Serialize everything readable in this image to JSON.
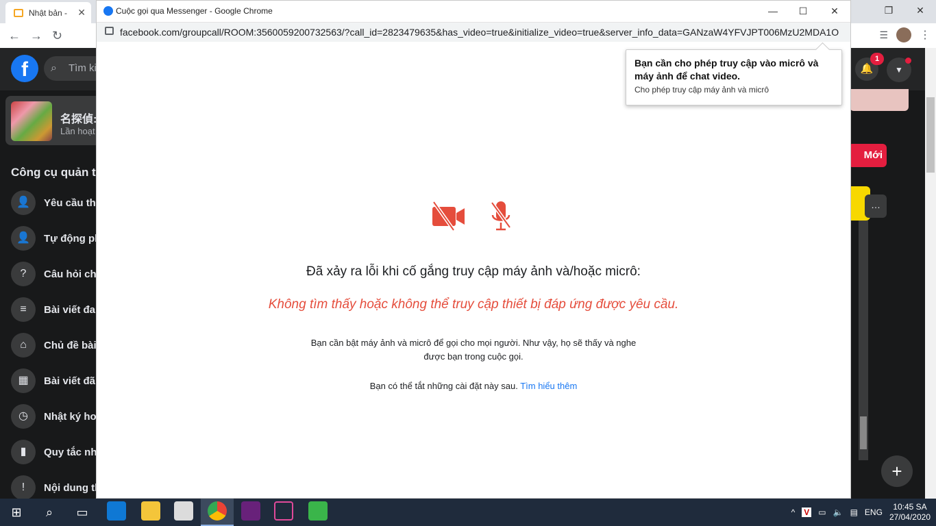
{
  "bg_browser": {
    "tab_title": "Nhật bản -",
    "tab_close": "✕"
  },
  "facebook": {
    "search_placeholder": "Tìm ki",
    "group_name": "名探偵:",
    "group_sub": "Lần hoạt",
    "tools_title": "Công cụ quản tr",
    "tools": [
      {
        "label": "Yêu cầu tha",
        "icon": "user-plus-icon"
      },
      {
        "label": "Tự động ph",
        "icon": "user-check-icon"
      },
      {
        "label": "Câu hỏi chọ",
        "icon": "member-questions-icon"
      },
      {
        "label": "Bài viết đan",
        "icon": "post-icon"
      },
      {
        "label": "Chủ đề bài",
        "icon": "tag-icon"
      },
      {
        "label": "Bài viết đã",
        "icon": "calendar-icon"
      },
      {
        "label": "Nhật ký ho",
        "icon": "clock-icon"
      },
      {
        "label": "Quy tắc nhó",
        "icon": "book-icon"
      },
      {
        "label": "Nội dung th",
        "icon": "alert-icon"
      }
    ],
    "notification_count": "1",
    "new_button": "Mới"
  },
  "popup": {
    "window_title": "Cuộc gọi qua Messenger - Google Chrome",
    "url": "facebook.com/groupcall/ROOM:3560059200732563/?call_id=2823479635&has_video=true&initialize_video=true&server_info_data=GANzaW4YFVJPT006MzU2MDA1O...",
    "tooltip_title": "Bạn cần cho phép truy cập vào micrô và máy ảnh để chat video.",
    "tooltip_sub": "Cho phép truy cập máy ảnh và micrô",
    "error_title": "Đã xảy ra lỗi khi cố gắng truy cập máy ảnh và/hoặc micrô:",
    "error_message": "Không tìm thấy hoặc không thể truy cập thiết bị đáp ứng được yêu cầu.",
    "description": "Bạn cần bật máy ảnh và micrô để gọi cho mọi người. Như vậy, họ sẽ thấy và nghe được bạn trong cuộc gọi.",
    "note_text": "Bạn có thể tắt những cài đặt này sau.",
    "learn_more": "Tìm hiểu thêm"
  },
  "taskbar": {
    "language": "ENG",
    "time": "10:45 SA",
    "date": "27/04/2020"
  },
  "colors": {
    "error_red": "#e54d3c",
    "link_blue": "#1877f2",
    "fb_blue": "#1877f2"
  }
}
